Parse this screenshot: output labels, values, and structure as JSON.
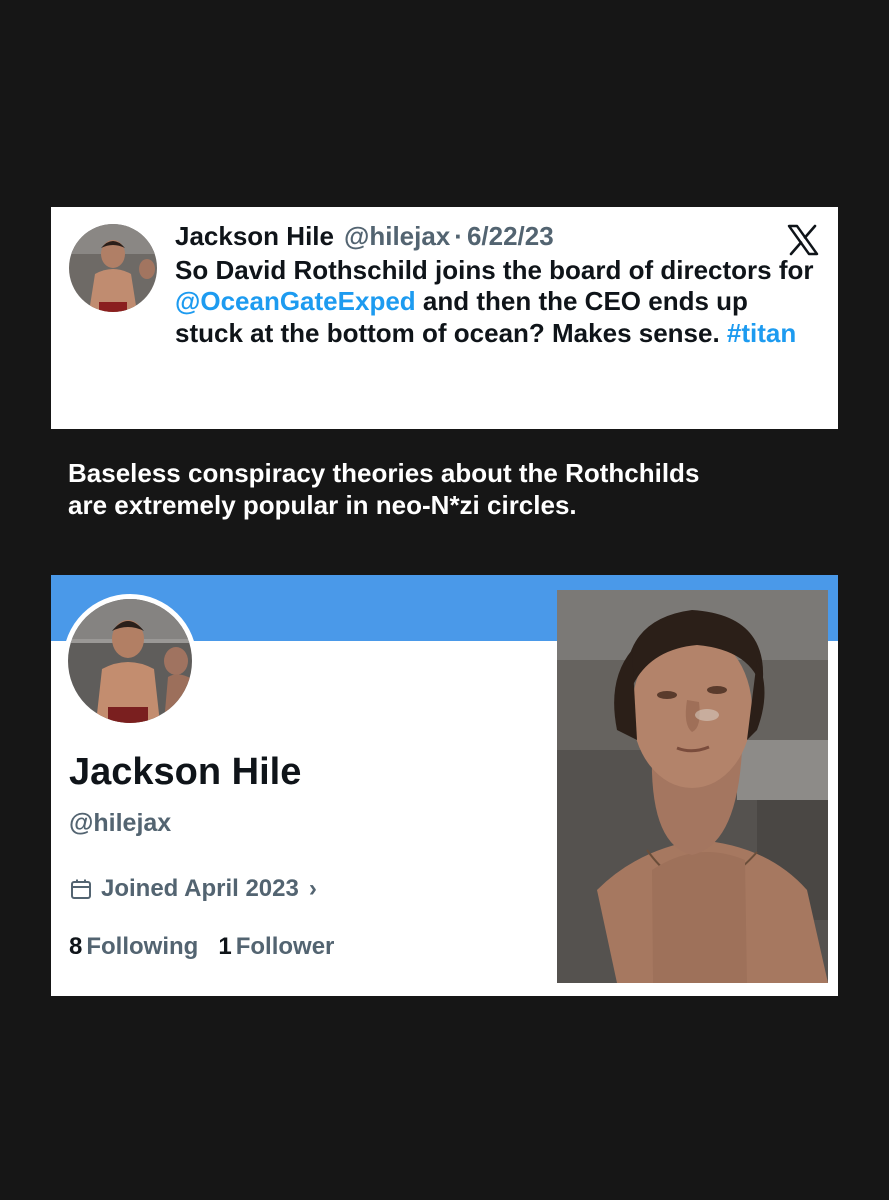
{
  "tweet": {
    "author_name": "Jackson Hile",
    "handle": "@hilejax",
    "separator": "·",
    "date": "6/22/23",
    "text_1": "So David Rothschild joins the board of directors for ",
    "mention": "@OceanGateExped",
    "text_2": " and then the CEO ends up stuck at the bottom of ocean? Makes sense. ",
    "hashtag": "#titan",
    "platform_icon": "x-logo-icon"
  },
  "caption": {
    "line_1": "Baseless conspiracy  theories about the Rothchilds",
    "line_2": "are extremely popular in neo-N*zi circles."
  },
  "profile": {
    "name": "Jackson Hile",
    "handle": "@hilejax",
    "joined": "Joined April 2023",
    "joined_chevron": "›",
    "following_count": "8",
    "following_label": "Following",
    "follower_count": "1",
    "follower_label": "Follower",
    "banner_color": "#4a99e9"
  },
  "colors": {
    "background": "#161616",
    "link": "#1d9bf0",
    "secondary_text": "#536471",
    "primary_text": "#0f1419"
  }
}
